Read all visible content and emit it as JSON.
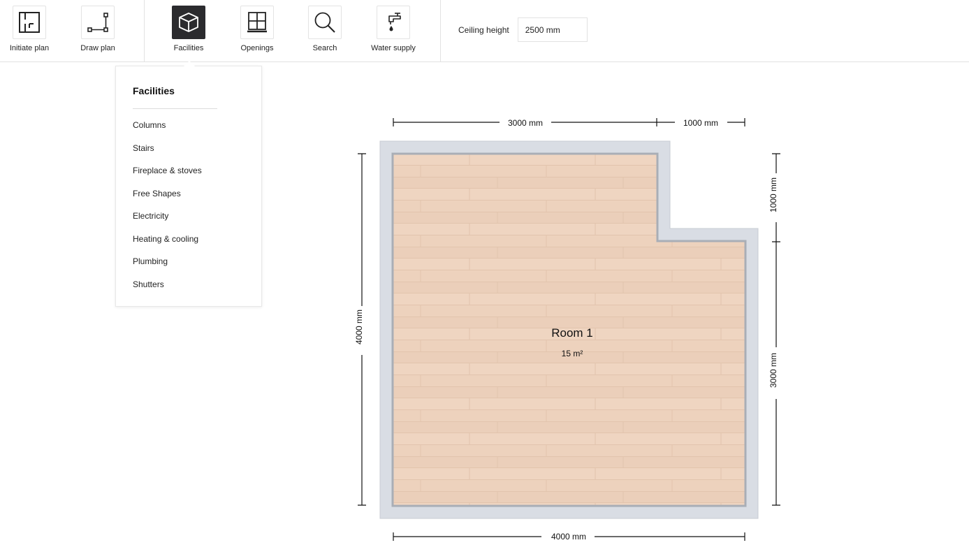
{
  "toolbar": {
    "tools": [
      {
        "label": "Initiate plan",
        "icon": "initiate-plan-icon"
      },
      {
        "label": "Draw plan",
        "icon": "draw-plan-icon"
      },
      {
        "label": "Facilities",
        "icon": "cube-icon"
      },
      {
        "label": "Openings",
        "icon": "window-icon"
      },
      {
        "label": "Search",
        "icon": "search-icon"
      },
      {
        "label": "Water supply",
        "icon": "faucet-icon"
      }
    ],
    "active_tool": "Facilities",
    "ceiling": {
      "label": "Ceiling height",
      "value": "2500 mm"
    }
  },
  "dropdown": {
    "title": "Facilities",
    "items": [
      "Columns",
      "Stairs",
      "Fireplace & stoves",
      "Free Shapes",
      "Electricity",
      "Heating & cooling",
      "Plumbing",
      "Shutters"
    ]
  },
  "plan": {
    "room": {
      "name": "Room 1",
      "area": "15 m²"
    },
    "dimensions": {
      "top_left": "3000 mm",
      "top_right": "1000 mm",
      "bottom": "4000 mm",
      "left": "4000 mm",
      "right_top": "1000 mm",
      "right_bottom": "3000 mm"
    }
  },
  "colors": {
    "wall": "#d9dde4",
    "wall_edge": "#a9aeb6",
    "floor": "#edd2bd",
    "active_tool_bg": "#2b2b2e"
  }
}
